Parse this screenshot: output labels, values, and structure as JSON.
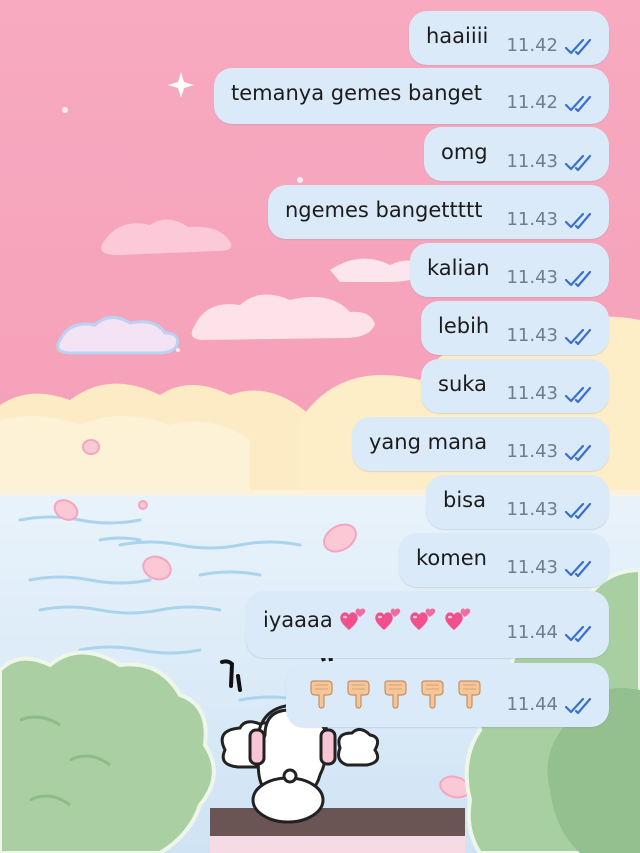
{
  "colors": {
    "bubble": "#dbeaf8",
    "tick": "#3b6fd0",
    "time": "#6f7e8c",
    "sky": "#f4a3bc",
    "sea": "#d3e6f6",
    "bush": "#a8cfa1"
  },
  "messages": [
    {
      "text": "haaiiii",
      "time": "11.42",
      "status": "read"
    },
    {
      "text": "temanya gemes banget",
      "time": "11.42",
      "status": "read"
    },
    {
      "text": "omg",
      "time": "11.43",
      "status": "read"
    },
    {
      "text": "ngemes bangettttt",
      "time": "11.43",
      "status": "read"
    },
    {
      "text": "kalian",
      "time": "11.43",
      "status": "read"
    },
    {
      "text": "lebih",
      "time": "11.43",
      "status": "read"
    },
    {
      "text": "suka",
      "time": "11.43",
      "status": "read"
    },
    {
      "text": "yang mana",
      "time": "11.43",
      "status": "read"
    },
    {
      "text": "bisa",
      "time": "11.43",
      "status": "read"
    },
    {
      "text": "komen",
      "time": "11.43",
      "status": "read"
    },
    {
      "text": "iyaaaa",
      "emoji": "two-hearts-emoji",
      "emoji_count": 4,
      "time": "11.44",
      "status": "read"
    },
    {
      "text": "",
      "emoji": "backhand-index-pointing-down-emoji",
      "emoji_count": 5,
      "time": "11.44",
      "status": "read"
    }
  ]
}
